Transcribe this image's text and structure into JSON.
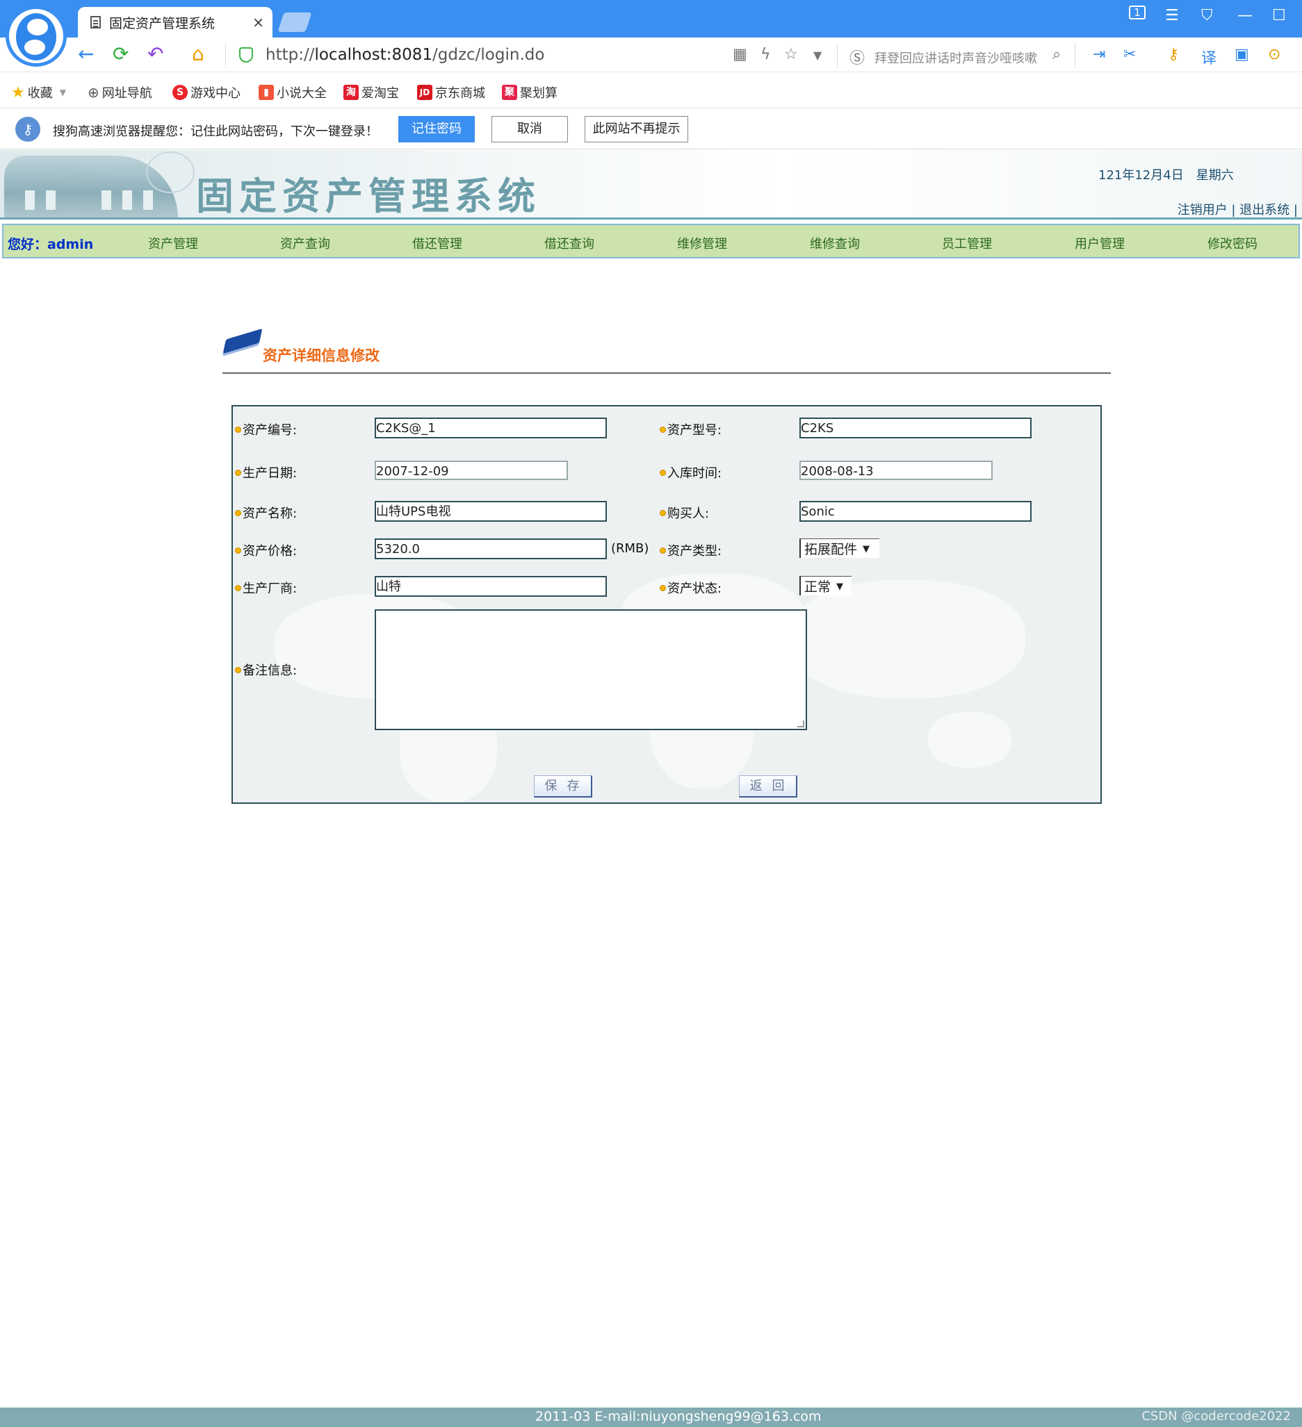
{
  "browser": {
    "tab_title": "固定资产管理系统",
    "tab_close": "×",
    "url_prefix": "http://",
    "url_host": "localhost:8081",
    "url_path": "/gdzc/login.do",
    "search_hint": "拜登回应讲话时声音沙哑咳嗽",
    "window_badge": "1"
  },
  "bookmarks": [
    {
      "label": "收藏",
      "icon": "star-icon"
    },
    {
      "label": "网址导航",
      "icon": "globe-icon"
    },
    {
      "label": "游戏中心",
      "icon": "game-icon"
    },
    {
      "label": "小说大全",
      "icon": "book-icon"
    },
    {
      "label": "爱淘宝",
      "icon": "taobao-icon",
      "glyph": "淘"
    },
    {
      "label": "京东商城",
      "icon": "jd-icon",
      "glyph": "JD"
    },
    {
      "label": "聚划算",
      "icon": "juhuasuan-icon",
      "glyph": "聚"
    }
  ],
  "password_bar": {
    "message": "搜狗高速浏览器提醒您：记住此网站密码，下次一键登录！",
    "remember": "记住密码",
    "cancel": "取消",
    "never": "此网站不再提示"
  },
  "header": {
    "system_title": "固定资产管理系统",
    "date": "121年12月4日　星期六",
    "links": "注销用户 | 退出系统 |"
  },
  "menu": {
    "greeting": "您好：admin",
    "items": [
      "资产管理",
      "资产查询",
      "借还管理",
      "借还查询",
      "维修管理",
      "维修查询",
      "员工管理",
      "用户管理",
      "修改密码"
    ]
  },
  "form": {
    "title": "资产详细信息修改",
    "fields": {
      "asset_no": {
        "label": "资产编号:",
        "value": "C2KS@_1"
      },
      "model": {
        "label": "资产型号:",
        "value": "C2KS"
      },
      "prod_date": {
        "label": "生产日期:",
        "value": "2007-12-09"
      },
      "stock_date": {
        "label": "入库时间:",
        "value": "2008-08-13"
      },
      "name": {
        "label": "资产名称:",
        "value": "山特UPS电视"
      },
      "buyer": {
        "label": "购买人:",
        "value": "Sonic"
      },
      "price": {
        "label": "资产价格:",
        "value": "5320.0",
        "unit": "(RMB)"
      },
      "type": {
        "label": "资产类型:",
        "value": "拓展配件"
      },
      "maker": {
        "label": "生产厂商:",
        "value": "山特"
      },
      "status": {
        "label": "资产状态:",
        "value": "正常"
      },
      "memo": {
        "label": "备注信息:",
        "value": ""
      }
    },
    "save": "保存",
    "back": "返回"
  },
  "footer": {
    "text": "2011-03 E-mail:niuyongsheng99@163.com",
    "watermark": "CSDN @codercode2022"
  },
  "colors": {
    "browser_blue": "#3a8ff0",
    "menu_bg": "#cce3ae",
    "title_orange": "#ec6a17",
    "footer_bg": "#82aab2"
  }
}
